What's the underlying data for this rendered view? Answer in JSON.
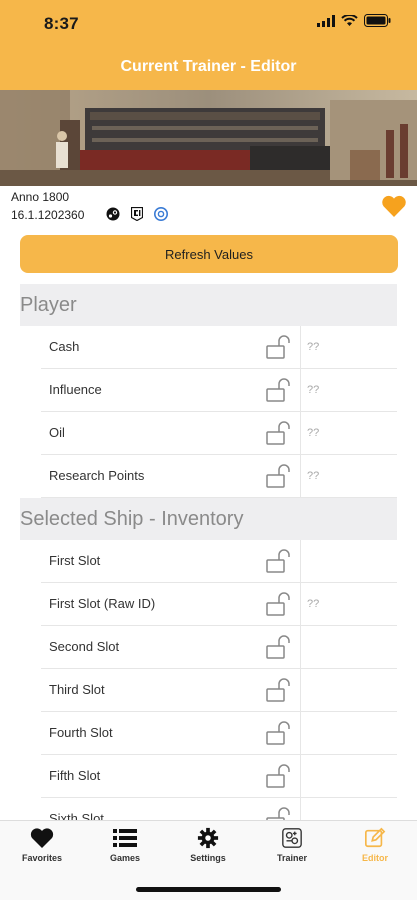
{
  "status_bar": {
    "time": "8:37"
  },
  "header": {
    "title": "Current Trainer - Editor"
  },
  "game": {
    "name": "Anno 1800",
    "version": "16.1.1202360",
    "platform_icons": [
      "steam-icon",
      "epic-icon",
      "ubisoft-icon"
    ],
    "favorite": true
  },
  "refresh_label": "Refresh Values",
  "sections": [
    {
      "title": "Player",
      "rows": [
        {
          "label": "Cash",
          "value": "??"
        },
        {
          "label": "Influence",
          "value": "??"
        },
        {
          "label": "Oil",
          "value": "??"
        },
        {
          "label": "Research Points",
          "value": "??"
        }
      ]
    },
    {
      "title": "Selected Ship - Inventory",
      "rows": [
        {
          "label": "First Slot",
          "value": ""
        },
        {
          "label": "First Slot (Raw ID)",
          "value": "??"
        },
        {
          "label": "Second Slot",
          "value": ""
        },
        {
          "label": "Third Slot",
          "value": ""
        },
        {
          "label": "Fourth Slot",
          "value": ""
        },
        {
          "label": "Fifth Slot",
          "value": ""
        },
        {
          "label": "Sixth Slot",
          "value": ""
        }
      ]
    }
  ],
  "tabs": [
    {
      "label": "Favorites",
      "icon": "heart-icon"
    },
    {
      "label": "Games",
      "icon": "list-icon"
    },
    {
      "label": "Settings",
      "icon": "gear-icon"
    },
    {
      "label": "Trainer",
      "icon": "trainer-icon"
    },
    {
      "label": "Editor",
      "icon": "edit-icon",
      "active": true
    }
  ],
  "colors": {
    "accent": "#F6B74A",
    "section_bg": "#EEEEF0"
  }
}
